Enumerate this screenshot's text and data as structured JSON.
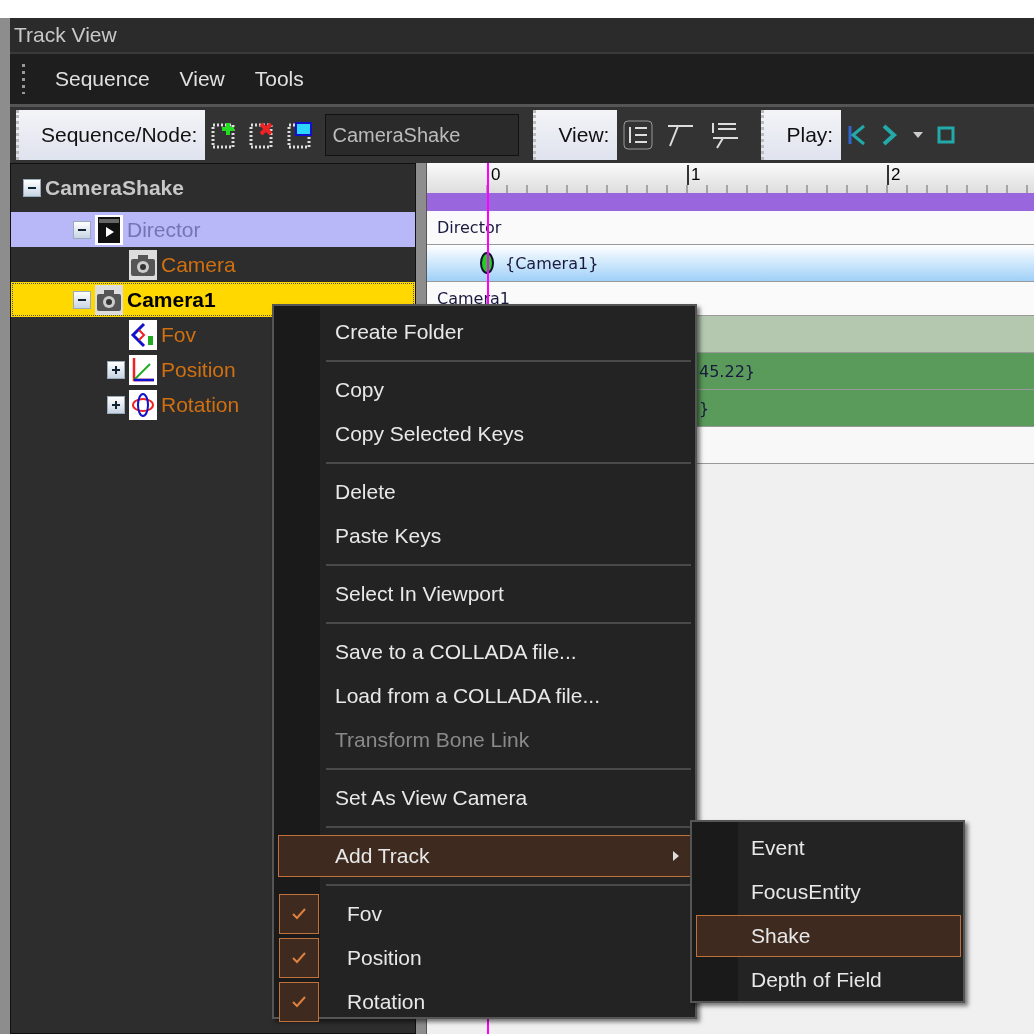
{
  "window": {
    "title": "Track View"
  },
  "menu_bar": [
    "Sequence",
    "View",
    "Tools"
  ],
  "toolbar": {
    "sequence_label": "Sequence/Node:",
    "sequence_name": "CameraShake",
    "view_label": "View:",
    "play_label": "Play:"
  },
  "tree": {
    "label": "CameraShake",
    "expanded": true,
    "children": [
      {
        "label": "Director",
        "kind": "director",
        "expanded": true,
        "active": true,
        "selected": false,
        "disabled": true,
        "children": [
          {
            "label": "Camera",
            "kind": "camera",
            "active": false,
            "selected": false,
            "disabled": false
          }
        ]
      },
      {
        "label": "Camera1",
        "kind": "camera",
        "expanded": true,
        "active": false,
        "selected": true,
        "disabled": false,
        "children": [
          {
            "label": "Fov",
            "kind": "fov",
            "active": false,
            "selected": false,
            "disabled": false
          },
          {
            "label": "Position",
            "kind": "position",
            "expanded": false,
            "active": false,
            "selected": false,
            "disabled": false
          },
          {
            "label": "Rotation",
            "kind": "rotation",
            "expanded": false,
            "active": false,
            "selected": false,
            "disabled": false
          }
        ]
      }
    ]
  },
  "timeline": {
    "ruler": [
      "0",
      "1",
      "2"
    ],
    "tracks": [
      {
        "kind": "label",
        "text": "Director"
      },
      {
        "kind": "key",
        "text": "{Camera1}"
      },
      {
        "kind": "label",
        "text": "Camera1"
      },
      {
        "kind": "light"
      },
      {
        "kind": "green",
        "text": "45.22}"
      },
      {
        "kind": "green",
        "text": "}"
      },
      {
        "kind": "blank"
      }
    ]
  },
  "context_menu": [
    {
      "kind": "item",
      "label": "Create Folder",
      "selected": false,
      "disabled": false
    },
    {
      "kind": "separator"
    },
    {
      "kind": "item",
      "label": "Copy",
      "selected": false,
      "disabled": false
    },
    {
      "kind": "item",
      "label": "Copy Selected Keys",
      "selected": false,
      "disabled": false
    },
    {
      "kind": "separator"
    },
    {
      "kind": "item",
      "label": "Delete",
      "selected": false,
      "disabled": false
    },
    {
      "kind": "item",
      "label": "Paste Keys",
      "selected": false,
      "disabled": false
    },
    {
      "kind": "separator"
    },
    {
      "kind": "item",
      "label": "Select In Viewport",
      "selected": false,
      "disabled": false
    },
    {
      "kind": "separator"
    },
    {
      "kind": "item",
      "label": "Save to a COLLADA file...",
      "selected": false,
      "disabled": false
    },
    {
      "kind": "item",
      "label": "Load from a COLLADA file...",
      "selected": false,
      "disabled": false
    },
    {
      "kind": "item",
      "label": "Transform Bone Link",
      "selected": false,
      "disabled": true
    },
    {
      "kind": "separator"
    },
    {
      "kind": "item",
      "label": "Set As View Camera",
      "selected": false,
      "disabled": false
    },
    {
      "kind": "separator"
    },
    {
      "kind": "submenu",
      "label": "Add Track",
      "selected": true,
      "disabled": false
    },
    {
      "kind": "separator"
    },
    {
      "kind": "check",
      "label": "Fov",
      "selected": false,
      "checked": true
    },
    {
      "kind": "check",
      "label": "Position",
      "selected": false,
      "checked": true
    },
    {
      "kind": "check",
      "label": "Rotation",
      "selected": false,
      "checked": true
    }
  ],
  "submenu": [
    {
      "label": "Event",
      "selected": false
    },
    {
      "label": "FocusEntity",
      "selected": false
    },
    {
      "label": "Shake",
      "selected": true
    },
    {
      "label": "Depth of Field",
      "selected": false
    }
  ]
}
